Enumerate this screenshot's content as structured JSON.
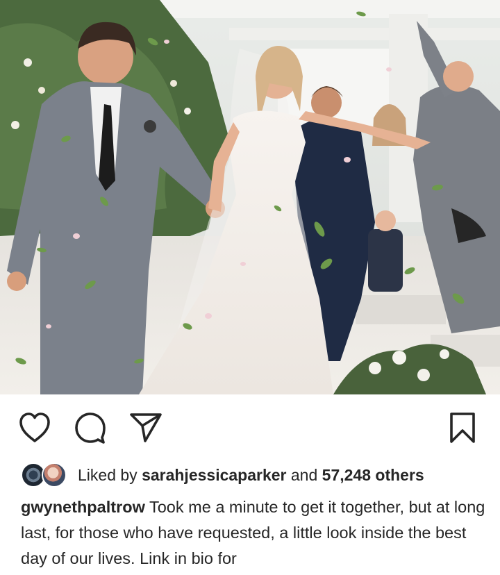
{
  "post": {
    "image_alt": "Wedding photo: couple walking down aisle with petals thrown by guests",
    "actions": {
      "like_icon": "heart-icon",
      "comment_icon": "comment-icon",
      "share_icon": "paper-plane-icon",
      "save_icon": "bookmark-icon"
    },
    "likes": {
      "prefix": "Liked by",
      "user": "sarahjessicaparker",
      "connector": "and",
      "others": "57,248 others"
    },
    "caption": {
      "username": "gwynethpaltrow",
      "text": "Took me a minute to get it together, but at long last, for those who have requested, a little look inside the best day of our lives. Link in bio for"
    }
  }
}
